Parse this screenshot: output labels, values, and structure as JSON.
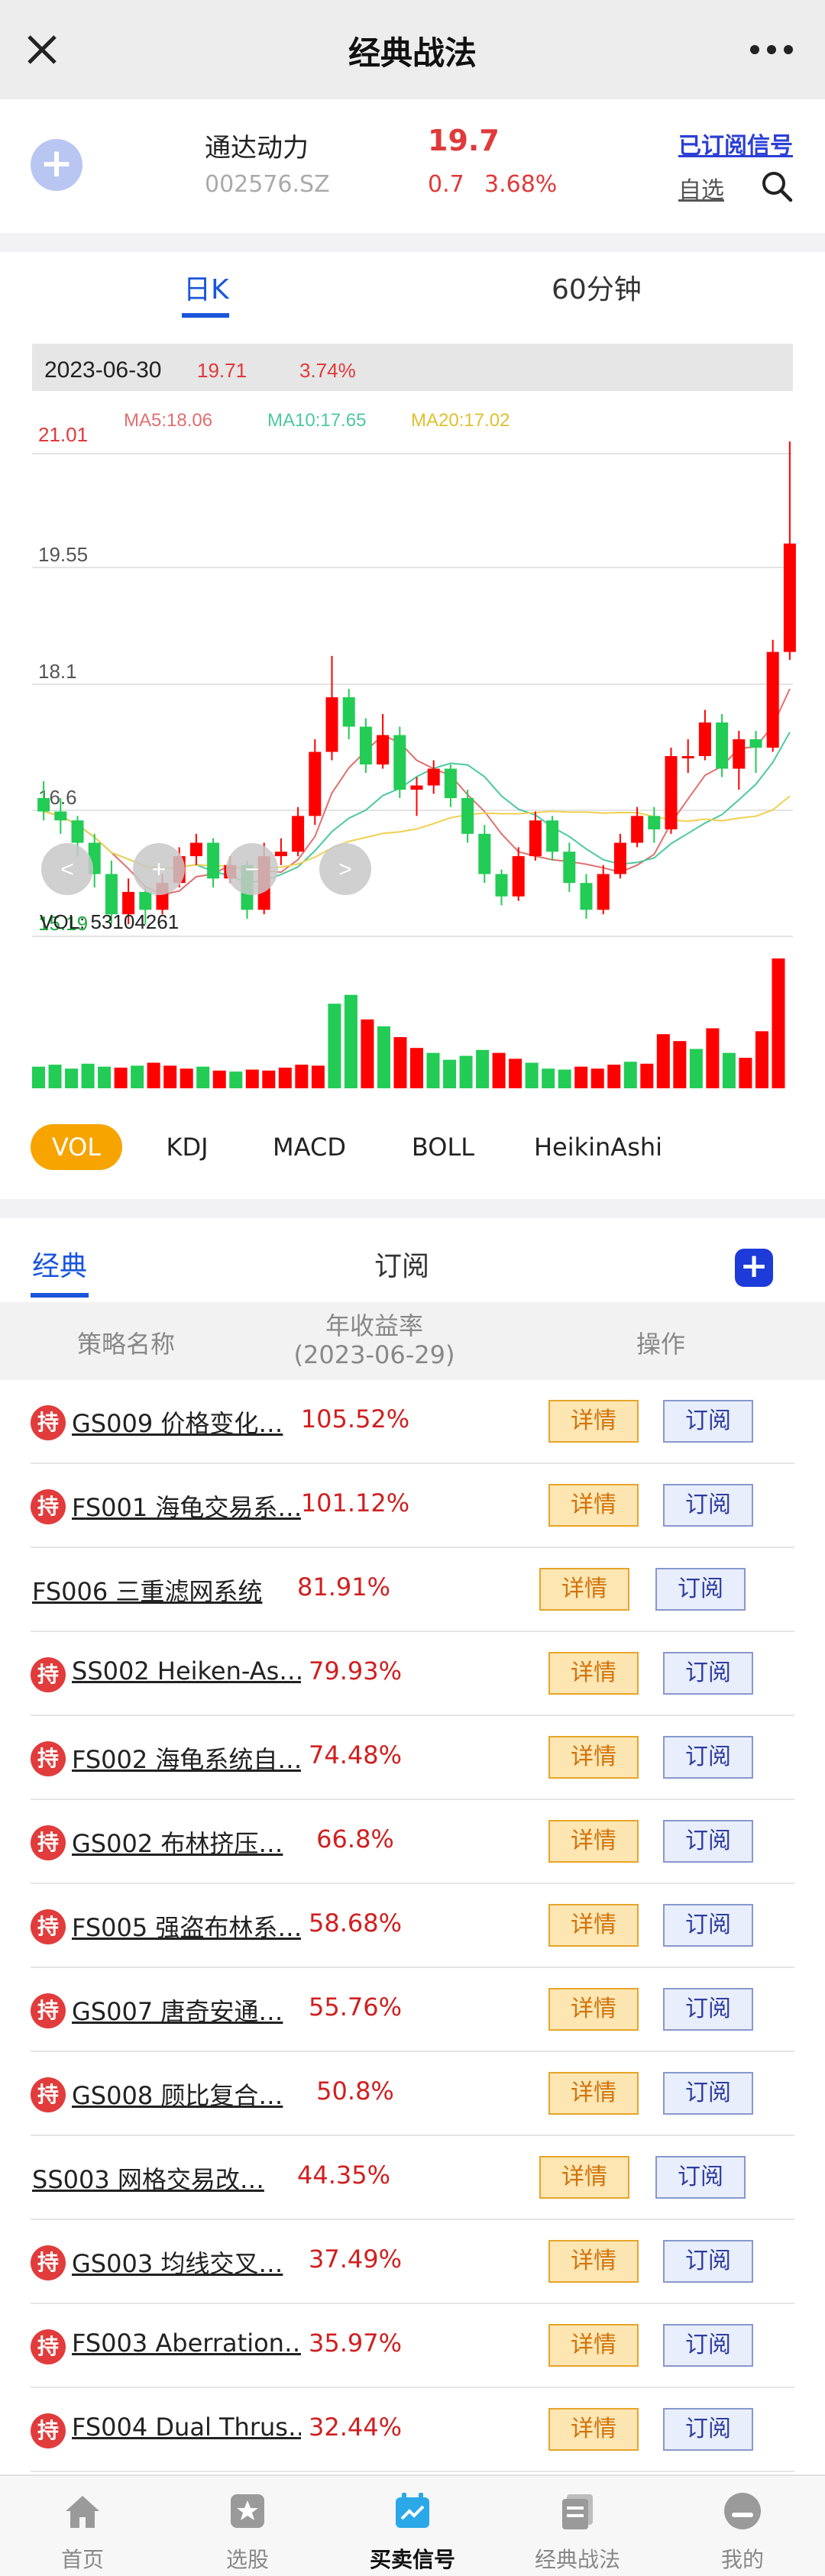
{
  "nav": {
    "title": "经典战法",
    "close_icon": "close-icon",
    "more_icon": "more-dots-icon"
  },
  "stock": {
    "name": "通达动力",
    "code": "002576.SZ",
    "price": "19.7",
    "change": "0.7",
    "change_pct": "3.68%",
    "subscribed_label": "已订阅信号",
    "watchlist_label": "自选",
    "accent_up": "#e03a3a"
  },
  "chart_tabs": [
    "日K",
    "60分钟"
  ],
  "chart_data": {
    "type": "candlestick",
    "date": "2023-06-30",
    "info_close": "19.71",
    "info_pct": "3.74%",
    "ma_labels": {
      "ma5": "MA5:18.06",
      "ma10": "MA10:17.65",
      "ma20": "MA20:17.02"
    },
    "price_ticks": [
      "21.01",
      "19.55",
      "18.1",
      "16.6",
      "15.19"
    ],
    "ylim": [
      15.19,
      21.01
    ],
    "volume_label": "VOL: 53104261",
    "colors": {
      "up": "#ff0000",
      "down": "#22cc55",
      "ma5": "#e07070",
      "ma10": "#4cc9a0",
      "ma20": "#f0d050"
    },
    "candles": [
      [
        16.6,
        16.45,
        16.8,
        16.35
      ],
      [
        16.45,
        16.35,
        16.6,
        16.2
      ],
      [
        16.35,
        16.1,
        16.4,
        15.95
      ],
      [
        16.1,
        15.75,
        16.2,
        15.6
      ],
      [
        15.75,
        15.3,
        15.9,
        15.2
      ],
      [
        15.3,
        15.55,
        15.7,
        15.15
      ],
      [
        15.55,
        15.35,
        15.6,
        15.19
      ],
      [
        15.35,
        15.65,
        15.75,
        15.3
      ],
      [
        15.65,
        15.95,
        16.05,
        15.6
      ],
      [
        15.95,
        16.1,
        16.2,
        15.85
      ],
      [
        16.1,
        15.7,
        16.15,
        15.6
      ],
      [
        15.7,
        15.85,
        15.95,
        15.65
      ],
      [
        15.85,
        15.35,
        15.9,
        15.25
      ],
      [
        15.35,
        15.95,
        16.1,
        15.3
      ],
      [
        15.95,
        16.0,
        16.15,
        15.85
      ],
      [
        16.0,
        16.4,
        16.5,
        15.95
      ],
      [
        16.4,
        17.15,
        17.3,
        16.3
      ],
      [
        17.15,
        17.8,
        18.3,
        17.05
      ],
      [
        17.8,
        17.45,
        17.9,
        17.3
      ],
      [
        17.45,
        17.0,
        17.55,
        16.9
      ],
      [
        17.0,
        17.35,
        17.6,
        16.95
      ],
      [
        17.35,
        16.7,
        17.45,
        16.6
      ],
      [
        16.7,
        16.75,
        16.85,
        16.4
      ],
      [
        16.75,
        16.95,
        17.05,
        16.65
      ],
      [
        16.95,
        16.6,
        17.0,
        16.5
      ],
      [
        16.6,
        16.2,
        16.7,
        16.1
      ],
      [
        16.2,
        15.75,
        16.3,
        15.65
      ],
      [
        15.75,
        15.5,
        15.8,
        15.4
      ],
      [
        15.5,
        15.95,
        16.05,
        15.45
      ],
      [
        15.95,
        16.35,
        16.45,
        15.9
      ],
      [
        16.35,
        16.0,
        16.4,
        15.9
      ],
      [
        16.0,
        15.65,
        16.1,
        15.55
      ],
      [
        15.65,
        15.35,
        15.75,
        15.25
      ],
      [
        15.35,
        15.75,
        15.85,
        15.3
      ],
      [
        15.75,
        16.1,
        16.2,
        15.7
      ],
      [
        16.1,
        16.4,
        16.5,
        16.05
      ],
      [
        16.4,
        16.25,
        16.5,
        16.1
      ],
      [
        16.25,
        17.1,
        17.2,
        16.2
      ],
      [
        17.1,
        17.1,
        17.3,
        16.9
      ],
      [
        17.1,
        17.5,
        17.65,
        17.05
      ],
      [
        17.5,
        16.95,
        17.6,
        16.85
      ],
      [
        16.95,
        17.3,
        17.4,
        16.7
      ],
      [
        17.3,
        17.2,
        17.4,
        16.9
      ],
      [
        17.2,
        18.35,
        18.5,
        17.15
      ],
      [
        18.35,
        19.7,
        21.01,
        18.25
      ]
    ],
    "volumes": [
      22,
      24,
      20,
      25,
      22,
      21,
      23,
      26,
      23,
      20,
      22,
      18,
      17,
      19,
      18,
      21,
      24,
      23,
      86,
      95,
      70,
      63,
      52,
      41,
      36,
      29,
      33,
      39,
      36,
      30,
      26,
      20,
      19,
      22,
      20,
      24,
      27,
      25,
      55,
      48,
      40,
      61,
      36,
      31,
      58,
      132
    ]
  },
  "indicator_tabs": [
    "VOL",
    "KDJ",
    "MACD",
    "BOLL",
    "HeikinAshi"
  ],
  "strategy": {
    "tabs": [
      "经典",
      "订阅"
    ],
    "headers": {
      "name": "策略名称",
      "rate_line1": "年收益率",
      "rate_line2": "(2023-06-29)",
      "op": "操作"
    },
    "hold_label": "持",
    "detail_label": "详情",
    "subscribe_label": "订阅",
    "rows": [
      {
        "name": "GS009 价格变化…",
        "rate": "105.52%",
        "held": true
      },
      {
        "name": "FS001 海龟交易系…",
        "rate": "101.12%",
        "held": true
      },
      {
        "name": "FS006 三重滤网系统",
        "rate": "81.91%",
        "held": false
      },
      {
        "name": "SS002 Heiken-As…",
        "rate": "79.93%",
        "held": true
      },
      {
        "name": "FS002 海龟系统自…",
        "rate": "74.48%",
        "held": true
      },
      {
        "name": "GS002 布林挤压…",
        "rate": "66.8%",
        "held": true
      },
      {
        "name": "FS005 强盗布林系…",
        "rate": "58.68%",
        "held": true
      },
      {
        "name": "GS007 唐奇安通…",
        "rate": "55.76%",
        "held": true
      },
      {
        "name": "GS008 顾比复合…",
        "rate": "50.8%",
        "held": true
      },
      {
        "name": "SS003 网格交易改…",
        "rate": "44.35%",
        "held": false
      },
      {
        "name": "GS003 均线交叉…",
        "rate": "37.49%",
        "held": true
      },
      {
        "name": "FS003 Aberration…",
        "rate": "35.97%",
        "held": true
      },
      {
        "name": "FS004 Dual Thrus…",
        "rate": "32.44%",
        "held": true
      }
    ]
  },
  "tabbar": [
    {
      "label": "首页",
      "icon": "home-icon"
    },
    {
      "label": "选股",
      "icon": "star-icon"
    },
    {
      "label": "买卖信号",
      "icon": "calendar-signal-icon",
      "active": true
    },
    {
      "label": "经典战法",
      "icon": "documents-icon"
    },
    {
      "label": "我的",
      "icon": "profile-icon"
    }
  ]
}
